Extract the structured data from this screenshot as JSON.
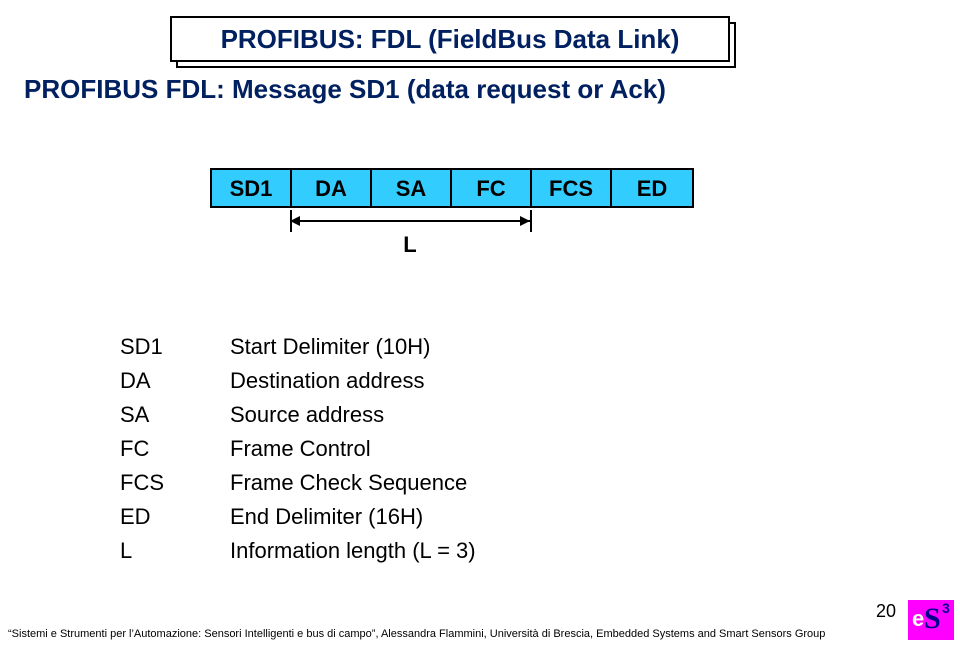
{
  "title": "PROFIBUS: FDL (FieldBus Data Link)",
  "subtitle": "PROFIBUS FDL: Message SD1 (data request or Ack)",
  "frame_fields": {
    "c0": "SD1",
    "c1": "DA",
    "c2": "SA",
    "c3": "FC",
    "c4": "FCS",
    "c5": "ED"
  },
  "dim_label": "L",
  "defs": [
    {
      "k": "SD1",
      "v": "Start Delimiter (10H)"
    },
    {
      "k": "DA",
      "v": "Destination address"
    },
    {
      "k": "SA",
      "v": "Source address"
    },
    {
      "k": "FC",
      "v": "Frame Control"
    },
    {
      "k": "FCS",
      "v": "Frame Check Sequence"
    },
    {
      "k": "ED",
      "v": "End Delimiter (16H)"
    },
    {
      "k": "L",
      "v": "Information length (L = 3)"
    }
  ],
  "footer": "“Sistemi e Strumenti per l’Automazione: Sensori Intelligenti e bus di campo”, Alessandra Flammini, Università di Brescia, Embedded Systems and Smart Sensors Group",
  "page_number": "20",
  "logo": {
    "e": "e",
    "S": "S",
    "n3": "3"
  }
}
